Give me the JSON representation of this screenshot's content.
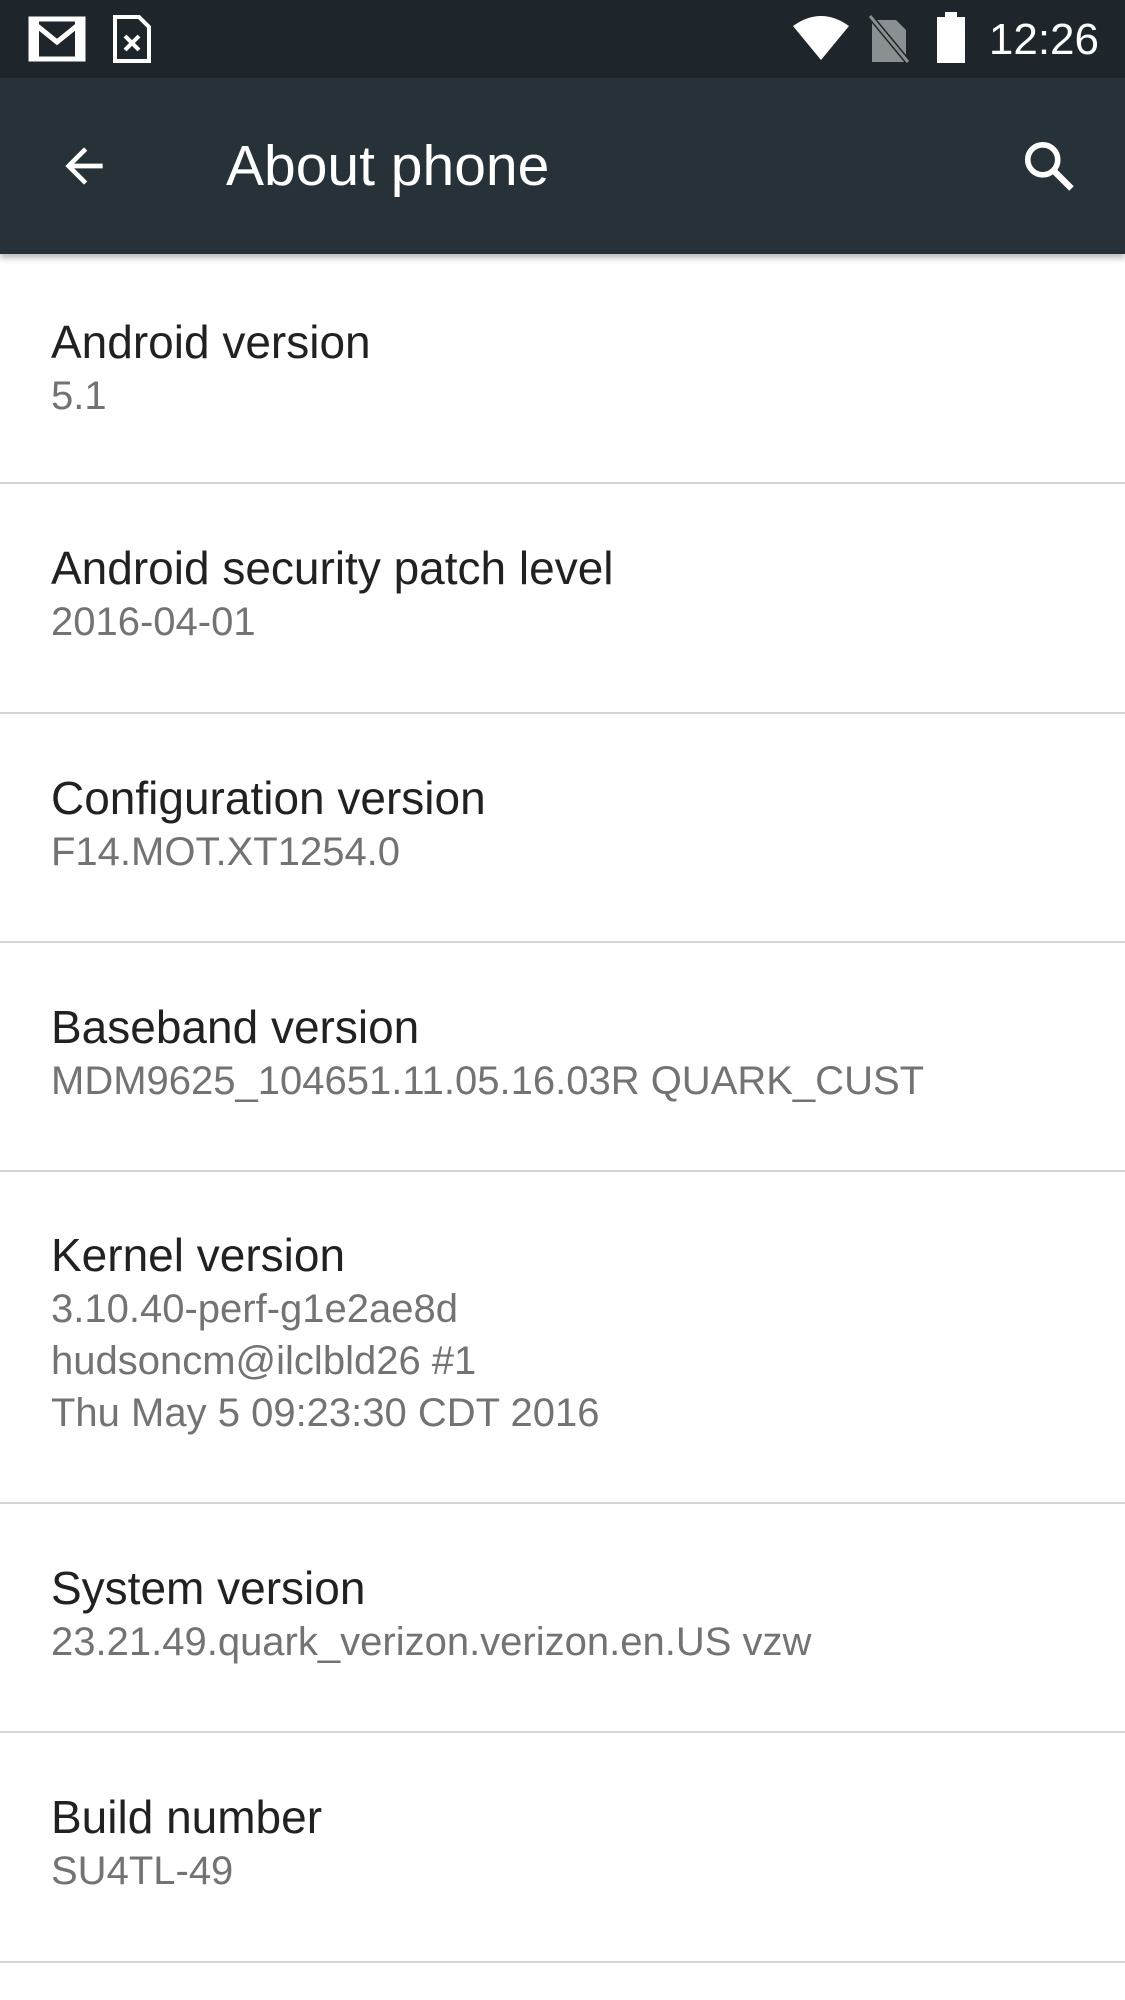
{
  "status_bar": {
    "time": "12:26",
    "left_icons": [
      "gmail-icon",
      "sim-card-error-icon"
    ],
    "right_icons": [
      "wifi-icon",
      "no-sim-icon",
      "battery-icon"
    ]
  },
  "app_bar": {
    "title": "About phone",
    "back_icon": "arrow-back-icon",
    "search_icon": "search-icon",
    "background": "#263238"
  },
  "items": [
    {
      "title": "Android version",
      "value": "5.1"
    },
    {
      "title": "Android security patch level",
      "value": "2016-04-01"
    },
    {
      "title": "Configuration version",
      "value": "F14.MOT.XT1254.0"
    },
    {
      "title": "Baseband version",
      "value": "MDM9625_104651.11.05.16.03R QUARK_CUST"
    },
    {
      "title": "Kernel version",
      "value": "3.10.40-perf-g1e2ae8d\nhudsoncm@ilclbld26 #1\nThu May 5 09:23:30 CDT 2016"
    },
    {
      "title": "System version",
      "value": "23.21.49.quark_verizon.verizon.en.US vzw"
    },
    {
      "title": "Build number",
      "value": "SU4TL-49"
    }
  ]
}
